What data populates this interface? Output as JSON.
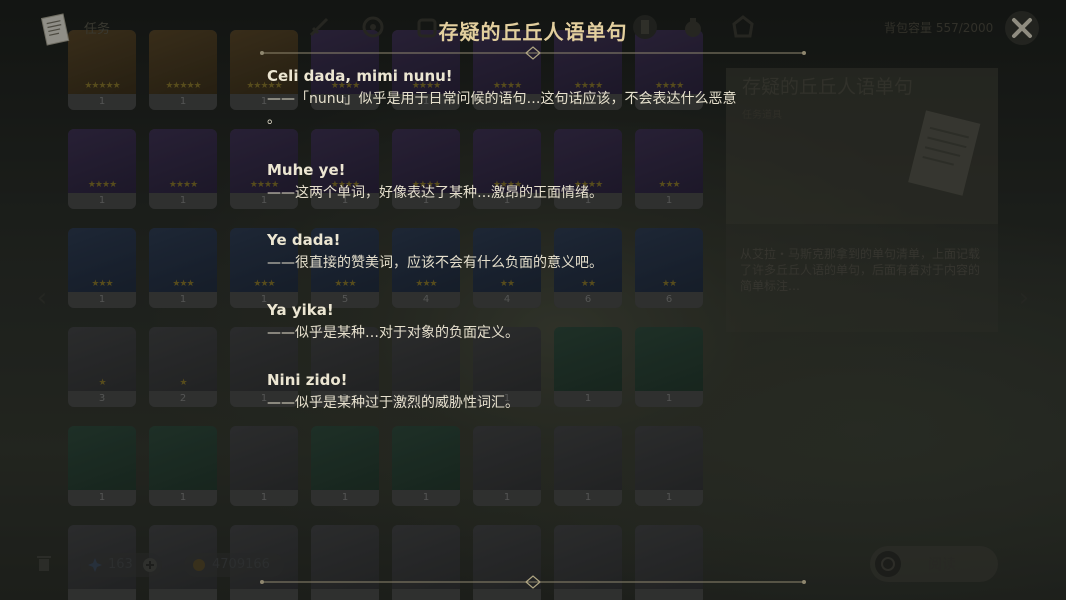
{
  "top_bar": {
    "tab_label": "任务",
    "capacity": "背包容量 557/2000"
  },
  "inventory": {
    "cells": [
      {
        "count": "1",
        "rarity": "gold",
        "stars": "★★★★★"
      },
      {
        "count": "1",
        "rarity": "gold",
        "stars": "★★★★★"
      },
      {
        "count": "1",
        "rarity": "gold",
        "stars": "★★★★★"
      },
      {
        "count": "1",
        "rarity": "purple",
        "stars": "★★★★"
      },
      {
        "count": "1",
        "rarity": "purple",
        "stars": "★★★★"
      },
      {
        "count": "1",
        "rarity": "purple",
        "stars": "★★★★"
      },
      {
        "count": "1",
        "rarity": "purple",
        "stars": "★★★★"
      },
      {
        "count": "1",
        "rarity": "purple",
        "stars": "★★★★"
      },
      {
        "count": "1",
        "rarity": "purple",
        "stars": "★★★★"
      },
      {
        "count": "1",
        "rarity": "purple",
        "stars": "★★★★"
      },
      {
        "count": "1",
        "rarity": "purple",
        "stars": "★★★★"
      },
      {
        "count": "1",
        "rarity": "purple",
        "stars": "★★★★"
      },
      {
        "count": "1",
        "rarity": "purple",
        "stars": "★★★★"
      },
      {
        "count": "1",
        "rarity": "purple",
        "stars": "★★★★"
      },
      {
        "count": "1",
        "rarity": "purple",
        "stars": "★★★★"
      },
      {
        "count": "1",
        "rarity": "purple",
        "stars": "★★★"
      },
      {
        "count": "1",
        "rarity": "blue",
        "stars": "★★★"
      },
      {
        "count": "1",
        "rarity": "blue",
        "stars": "★★★"
      },
      {
        "count": "1",
        "rarity": "blue",
        "stars": "★★★"
      },
      {
        "count": "5",
        "rarity": "blue",
        "stars": "★★★"
      },
      {
        "count": "4",
        "rarity": "blue",
        "stars": "★★★"
      },
      {
        "count": "4",
        "rarity": "blue",
        "stars": "★★"
      },
      {
        "count": "6",
        "rarity": "blue",
        "stars": "★★"
      },
      {
        "count": "6",
        "rarity": "blue",
        "stars": "★★"
      },
      {
        "count": "3",
        "rarity": "grey",
        "stars": "★"
      },
      {
        "count": "2",
        "rarity": "grey",
        "stars": "★"
      },
      {
        "count": "1",
        "rarity": "grey",
        "stars": ""
      },
      {
        "count": "1",
        "rarity": "grey",
        "stars": ""
      },
      {
        "count": "1",
        "rarity": "grey",
        "stars": ""
      },
      {
        "count": "1",
        "rarity": "grey",
        "stars": ""
      },
      {
        "count": "1",
        "rarity": "green",
        "stars": ""
      },
      {
        "count": "1",
        "rarity": "green",
        "stars": ""
      },
      {
        "count": "1",
        "rarity": "green",
        "stars": ""
      },
      {
        "count": "1",
        "rarity": "green",
        "stars": ""
      },
      {
        "count": "1",
        "rarity": "grey",
        "stars": ""
      },
      {
        "count": "1",
        "rarity": "green",
        "stars": ""
      },
      {
        "count": "1",
        "rarity": "green",
        "stars": ""
      },
      {
        "count": "1",
        "rarity": "grey",
        "stars": ""
      },
      {
        "count": "1",
        "rarity": "grey",
        "stars": ""
      },
      {
        "count": "1",
        "rarity": "grey",
        "stars": ""
      },
      {
        "count": "",
        "rarity": "grey",
        "stars": ""
      },
      {
        "count": "",
        "rarity": "grey",
        "stars": ""
      },
      {
        "count": "",
        "rarity": "grey",
        "stars": ""
      },
      {
        "count": "",
        "rarity": "grey",
        "stars": ""
      },
      {
        "count": "",
        "rarity": "grey",
        "stars": ""
      },
      {
        "count": "",
        "rarity": "grey",
        "stars": ""
      },
      {
        "count": "",
        "rarity": "grey",
        "stars": ""
      },
      {
        "count": "",
        "rarity": "grey",
        "stars": ""
      }
    ]
  },
  "detail": {
    "title": "存疑的丘丘人语单句",
    "subtitle": "任务道具",
    "description": "从艾拉・马斯克那拿到的单句清单，上面记载了许多丘丘人语的单句，后面有着对于内容的简单标注…"
  },
  "bottom_bar": {
    "currency_1": "163",
    "currency_2": "4709166",
    "read_label": "阅读"
  },
  "dialog": {
    "title": "存疑的丘丘人语单句",
    "entries": [
      {
        "phrase": "Celi dada, mimi nunu!",
        "explain": "——「nunu」似乎是用于日常问候的语句…这句话应该，不会表达什么恶意\n。"
      },
      {
        "phrase": "Muhe ye!",
        "explain": "——这两个单词，好像表达了某种…激昂的正面情绪。"
      },
      {
        "phrase": "Ye dada!",
        "explain": "——很直接的赞美词，应该不会有什么负面的意义吧。"
      },
      {
        "phrase": "Ya yika!",
        "explain": "——似乎是某种…对于对象的负面定义。"
      },
      {
        "phrase": "Nini zido!",
        "explain": "——似乎是某种过于激烈的威胁性词汇。"
      }
    ]
  },
  "colors": {
    "title_gold": "#e3cf9e",
    "text_cream": "#ece6d2"
  }
}
